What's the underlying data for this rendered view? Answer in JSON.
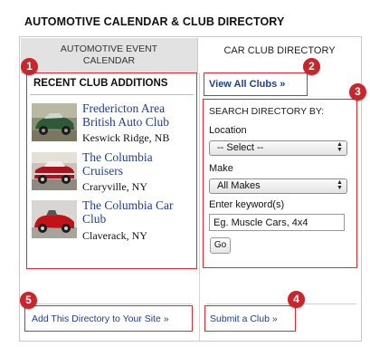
{
  "header": {
    "title": "AUTOMOTIVE CALENDAR & CLUB DIRECTORY"
  },
  "tabs": {
    "event_calendar_line1": "AUTOMOTIVE EVENT",
    "event_calendar_line2": "CALENDAR",
    "club_directory": "CAR CLUB DIRECTORY"
  },
  "recent": {
    "heading": "RECENT CLUB ADDITIONS",
    "clubs": [
      {
        "name": "Fredericton Area British Auto Club",
        "location": "Keswick Ridge, NB"
      },
      {
        "name": "The Columbia Cruisers",
        "location": "Craryville, NY"
      },
      {
        "name": "The Columbia Car Club",
        "location": "Claverack, NY"
      }
    ]
  },
  "search": {
    "view_all": "View All Clubs »",
    "heading": "SEARCH DIRECTORY BY:",
    "location_label": "Location",
    "location_value": "-- Select --",
    "make_label": "Make",
    "make_value": "All Makes",
    "keyword_label": "Enter keyword(s)",
    "keyword_placeholder": "Eg. Muscle Cars, 4x4",
    "go_label": "Go"
  },
  "footer": {
    "add_directory": "Add This Directory to Your Site »",
    "submit_club": "Submit a Club »"
  },
  "callouts": [
    "1",
    "2",
    "3",
    "4",
    "5"
  ],
  "colors": {
    "accent_red": "#c8262d",
    "link_blue": "#1f3f8f",
    "tab_gray": "#e2e2e2"
  }
}
